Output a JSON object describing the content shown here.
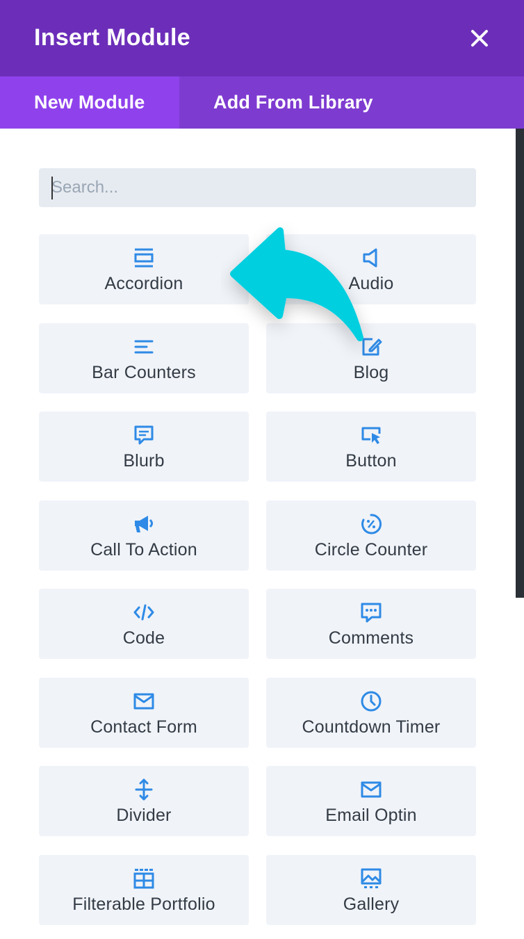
{
  "header": {
    "title": "Insert Module",
    "close_icon": "close-icon"
  },
  "tabs": [
    {
      "label": "New Module",
      "active": true
    },
    {
      "label": "Add From Library",
      "active": false
    }
  ],
  "search": {
    "placeholder": "Search...",
    "value": ""
  },
  "colors": {
    "header_bg": "#6c2eb9",
    "tab_bar_bg": "#7e3bd0",
    "active_tab_bg": "#8f42ec",
    "module_bg": "#f0f3f8",
    "icon_color": "#2e8ae6",
    "arrow_color": "#00cfe0"
  },
  "modules": [
    {
      "label": "Accordion",
      "icon": "accordion-icon"
    },
    {
      "label": "Audio",
      "icon": "audio-icon"
    },
    {
      "label": "Bar Counters",
      "icon": "bar-counters-icon"
    },
    {
      "label": "Blog",
      "icon": "blog-icon"
    },
    {
      "label": "Blurb",
      "icon": "blurb-icon"
    },
    {
      "label": "Button",
      "icon": "button-icon"
    },
    {
      "label": "Call To Action",
      "icon": "call-to-action-icon"
    },
    {
      "label": "Circle Counter",
      "icon": "circle-counter-icon"
    },
    {
      "label": "Code",
      "icon": "code-icon"
    },
    {
      "label": "Comments",
      "icon": "comments-icon"
    },
    {
      "label": "Contact Form",
      "icon": "contact-form-icon"
    },
    {
      "label": "Countdown Timer",
      "icon": "countdown-timer-icon"
    },
    {
      "label": "Divider",
      "icon": "divider-icon"
    },
    {
      "label": "Email Optin",
      "icon": "email-optin-icon"
    },
    {
      "label": "Filterable Portfolio",
      "icon": "filterable-portfolio-icon"
    },
    {
      "label": "Gallery",
      "icon": "gallery-icon"
    }
  ]
}
